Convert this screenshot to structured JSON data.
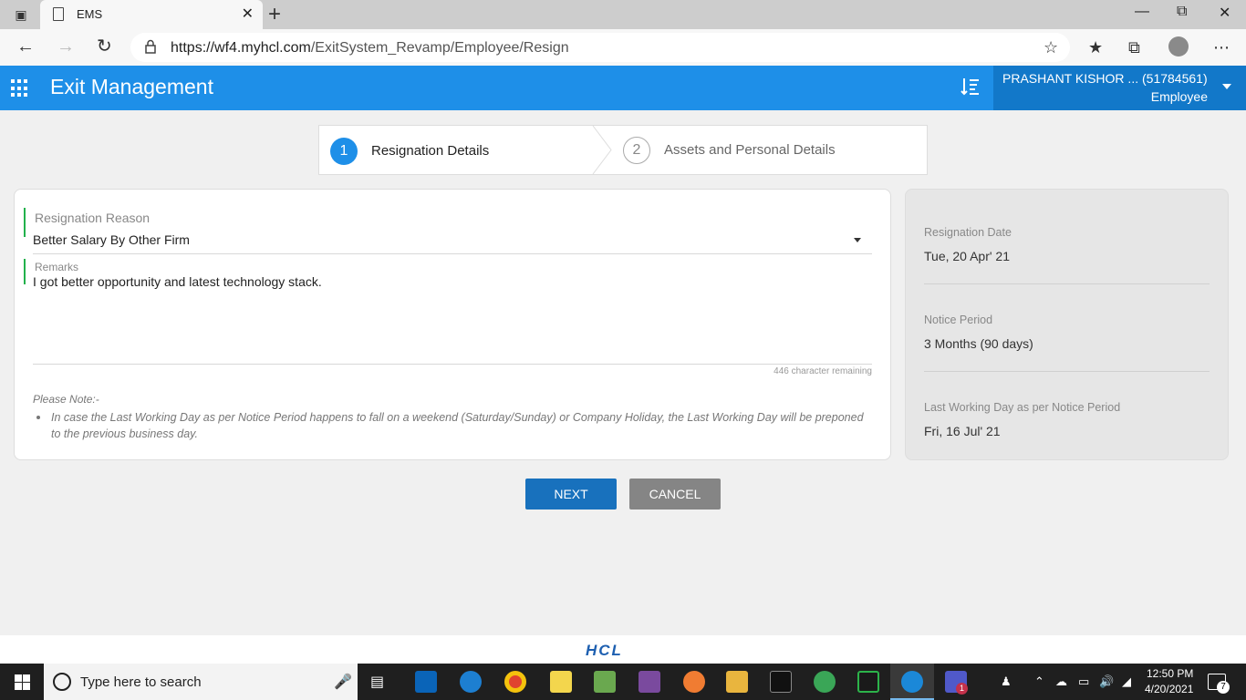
{
  "browser": {
    "tab_title": "EMS",
    "url_host": "https://wf4.myhcl.com",
    "url_path": "/ExitSystem_Revamp/Employee/Resign"
  },
  "app": {
    "title": "Exit Management",
    "user_name": "PRASHANT KISHOR ...  (51784561)",
    "user_role": "Employee"
  },
  "stepper": {
    "steps": [
      {
        "number": "1",
        "label": "Resignation Details"
      },
      {
        "number": "2",
        "label": "Assets and Personal Details"
      }
    ]
  },
  "form": {
    "reason_label": "Resignation Reason",
    "reason_value": "Better Salary By Other Firm",
    "remarks_label": "Remarks",
    "remarks_value": "I got better opportunity  and latest technology stack.",
    "char_remaining": "446 character remaining",
    "note_title": "Please Note:-",
    "note_item": "In case the Last Working Day as per Notice Period happens to fall on a weekend (Saturday/Sunday) or Company Holiday, the Last Working Day will be preponed to the previous business day."
  },
  "summary": {
    "items": [
      {
        "label": "Resignation Date",
        "value": "Tue, 20 Apr' 21"
      },
      {
        "label": "Notice Period",
        "value": "3 Months (90 days)"
      },
      {
        "label": "Last Working Day as per Notice Period",
        "value": "Fri, 16 Jul' 21"
      }
    ]
  },
  "buttons": {
    "next": "NEXT",
    "cancel": "CANCEL"
  },
  "footer": {
    "logo_text": "HCL"
  },
  "taskbar": {
    "search_placeholder": "Type here to search",
    "time": "12:50 PM",
    "date": "4/20/2021",
    "notification_count": "7",
    "teams_badge": "1"
  },
  "colors": {
    "app_bar": "#1e8fe8",
    "user_panel": "#1278c9",
    "primary_button": "#1871bd",
    "secondary_button": "#858585",
    "field_accent": "#22b14c"
  }
}
